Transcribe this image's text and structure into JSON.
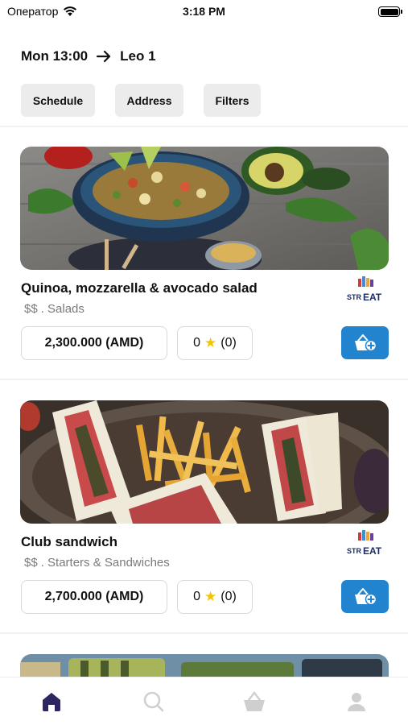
{
  "status_bar": {
    "carrier": "Оператор",
    "time": "3:18 PM"
  },
  "header": {
    "day_time": "Mon 13:00",
    "destination": "Leo 1"
  },
  "filters": {
    "schedule_label": "Schedule",
    "address_label": "Address",
    "filters_label": "Filters"
  },
  "items": [
    {
      "title": "Quinoa, mozzarella & avocado salad",
      "price_level": "$$",
      "category": ". Salads",
      "price": "2,300.000 (AMD)",
      "rating_value": "0",
      "rating_count": "(0)",
      "vendor_logo_text": "STREAT"
    },
    {
      "title": "Club sandwich",
      "price_level": "$$",
      "category": ". Starters & Sandwiches",
      "price": "2,700.000 (AMD)",
      "rating_value": "0",
      "rating_count": "(0)",
      "vendor_logo_text": "STREAT"
    }
  ],
  "icons": {
    "wifi": "wifi-icon",
    "battery": "battery-icon",
    "arrow": "arrow-right-icon",
    "star": "star-icon",
    "cart": "add-to-cart-icon",
    "home": "home-icon",
    "search": "search-icon",
    "basket": "basket-icon",
    "profile": "profile-icon"
  },
  "colors": {
    "accent_blue": "#2284cf",
    "active_tab": "#2b2660",
    "inactive_tab": "#cfcfcf",
    "star": "#f5c400",
    "chip_bg": "#ececec"
  }
}
